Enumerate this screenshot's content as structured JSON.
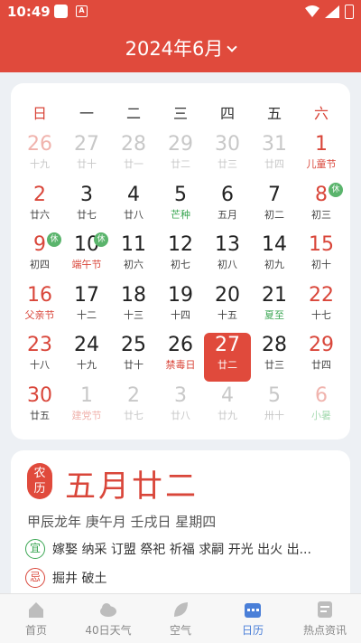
{
  "status_bar": {
    "time": "10:49",
    "icons": [
      "notification-icon",
      "a-icon",
      "wifi-icon",
      "battery-charging-icon"
    ]
  },
  "header": {
    "title": "2024年6月"
  },
  "weekdays": [
    "日",
    "一",
    "二",
    "三",
    "四",
    "五",
    "六"
  ],
  "days": [
    {
      "num": "26",
      "lunar": "十九",
      "other": true,
      "weekend": true
    },
    {
      "num": "27",
      "lunar": "廿十",
      "other": true
    },
    {
      "num": "28",
      "lunar": "廿一",
      "other": true
    },
    {
      "num": "29",
      "lunar": "廿二",
      "other": true
    },
    {
      "num": "30",
      "lunar": "廿三",
      "other": true
    },
    {
      "num": "31",
      "lunar": "廿四",
      "other": true
    },
    {
      "num": "1",
      "lunar": "儿童节",
      "weekend": true,
      "festival": true
    },
    {
      "num": "2",
      "lunar": "廿六",
      "weekend": true
    },
    {
      "num": "3",
      "lunar": "廿七"
    },
    {
      "num": "4",
      "lunar": "廿八"
    },
    {
      "num": "5",
      "lunar": "芒种",
      "term": true
    },
    {
      "num": "6",
      "lunar": "五月"
    },
    {
      "num": "7",
      "lunar": "初二"
    },
    {
      "num": "8",
      "lunar": "初三",
      "weekend": true,
      "rest": "休"
    },
    {
      "num": "9",
      "lunar": "初四",
      "weekend": true,
      "rest": "休"
    },
    {
      "num": "10",
      "lunar": "端午节",
      "festival": true,
      "rest": "休"
    },
    {
      "num": "11",
      "lunar": "初六"
    },
    {
      "num": "12",
      "lunar": "初七"
    },
    {
      "num": "13",
      "lunar": "初八"
    },
    {
      "num": "14",
      "lunar": "初九"
    },
    {
      "num": "15",
      "lunar": "初十",
      "weekend": true
    },
    {
      "num": "16",
      "lunar": "父亲节",
      "weekend": true,
      "festival": true
    },
    {
      "num": "17",
      "lunar": "十二"
    },
    {
      "num": "18",
      "lunar": "十三"
    },
    {
      "num": "19",
      "lunar": "十四"
    },
    {
      "num": "20",
      "lunar": "十五"
    },
    {
      "num": "21",
      "lunar": "夏至",
      "term": true
    },
    {
      "num": "22",
      "lunar": "十七",
      "weekend": true
    },
    {
      "num": "23",
      "lunar": "十八",
      "weekend": true
    },
    {
      "num": "24",
      "lunar": "十九"
    },
    {
      "num": "25",
      "lunar": "廿十"
    },
    {
      "num": "26",
      "lunar": "禁毒日",
      "festival": true
    },
    {
      "num": "27",
      "lunar": "廿二",
      "selected": true
    },
    {
      "num": "28",
      "lunar": "廿三"
    },
    {
      "num": "29",
      "lunar": "廿四",
      "weekend": true
    },
    {
      "num": "30",
      "lunar": "廿五",
      "weekend": true
    },
    {
      "num": "1",
      "lunar": "建党节",
      "other": true,
      "festival": true
    },
    {
      "num": "2",
      "lunar": "廿七",
      "other": true
    },
    {
      "num": "3",
      "lunar": "廿八",
      "other": true
    },
    {
      "num": "4",
      "lunar": "廿九",
      "other": true
    },
    {
      "num": "5",
      "lunar": "卅十",
      "other": true
    },
    {
      "num": "6",
      "lunar": "小暑",
      "other": true,
      "weekend": true,
      "term": true
    }
  ],
  "detail": {
    "badge_top": "农",
    "badge_bottom": "历",
    "lunar_date": "五月廿二",
    "ganzhi": "甲辰龙年 庚午月 壬戌日 星期四",
    "yi_label": "宜",
    "yi_text": "嫁娶 纳采 订盟 祭祀 祈福 求嗣 开光 出火 出...",
    "ji_label": "忌",
    "ji_text": "掘井 破土"
  },
  "tabs": [
    {
      "label": "首页",
      "icon": "home-icon"
    },
    {
      "label": "40日天气",
      "icon": "cloud-icon"
    },
    {
      "label": "空气",
      "icon": "leaf-icon"
    },
    {
      "label": "日历",
      "icon": "calendar-icon",
      "active": true
    },
    {
      "label": "热点资讯",
      "icon": "news-icon"
    }
  ],
  "colors": {
    "accent": "#e04a3c",
    "term_green": "#3aa652",
    "tab_active": "#4a7fd8"
  }
}
